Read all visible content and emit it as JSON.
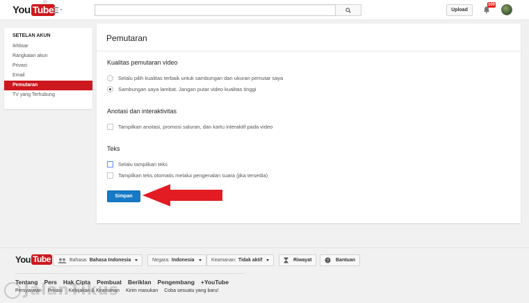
{
  "header": {
    "logo_you": "You",
    "logo_tube": "Tube",
    "logo_country": "ID",
    "search": {
      "value": "",
      "placeholder": ""
    },
    "upload_label": "Upload",
    "notification_count": "100",
    "icons": {
      "guide": "hamburger-icon",
      "search": "search-icon",
      "bell": "bell-icon"
    }
  },
  "sidebar": {
    "heading": "SETELAN AKUN",
    "items": [
      {
        "label": "Ikhtisar",
        "active": false
      },
      {
        "label": "Rangkaian akun",
        "active": false
      },
      {
        "label": "Privasi",
        "active": false
      },
      {
        "label": "Email",
        "active": false
      },
      {
        "label": "Pemutaran",
        "active": true
      },
      {
        "label": "TV yang Terhubung",
        "active": false
      }
    ]
  },
  "main": {
    "title": "Pemutaran",
    "sections": {
      "quality": {
        "title": "Kualitas pemutaran video",
        "options": [
          {
            "label": "Selalu pilih kualitas terbaik untuk sambungan dan ukuran pemutar saya",
            "checked": false
          },
          {
            "label": "Sambungan saya lambat. Jangan putar video kualitas tinggi",
            "checked": true
          }
        ]
      },
      "annotations": {
        "title": "Anotasi dan interaktivitas",
        "options": [
          {
            "label": "Tampilkan anotasi, promosi saluran, dan kartu interaktif pada video",
            "checked": false
          }
        ]
      },
      "captions": {
        "title": "Teks",
        "options": [
          {
            "label": "Selalu tampilkan teks",
            "checked": false
          },
          {
            "label": "Tampilkan teks otomatis melalui pengenalan suara (jika tersedia)",
            "checked": false
          }
        ]
      }
    },
    "save_label": "Simpan"
  },
  "annotation_arrow": {
    "color": "#e31b23",
    "points_to": "save-button"
  },
  "footer": {
    "logo_you": "You",
    "logo_tube": "Tube",
    "language": {
      "label": "Bahasa:",
      "value": "Bahasa Indonesia"
    },
    "country": {
      "label": "Negara:",
      "value": "Indonesia"
    },
    "safety": {
      "label": "Keamanan:",
      "value": "Tidak aktif"
    },
    "history_label": "Riwayat",
    "help_label": "Bantuan",
    "links_primary": [
      "Tentang",
      "Pers",
      "Hak Cipta",
      "Pembuat",
      "Beriklan",
      "Pengembang",
      "+YouTube"
    ],
    "links_secondary": [
      "Persyaratan",
      "Privasi",
      "Kebijakan & Keamanan",
      "Kirim masukan",
      "Coba sesuatu yang baru!"
    ]
  },
  "watermark": "JalanTikus",
  "colors": {
    "brand_red": "#cc181e",
    "primary_blue": "#167ac6",
    "arrow_red": "#e31b23"
  }
}
